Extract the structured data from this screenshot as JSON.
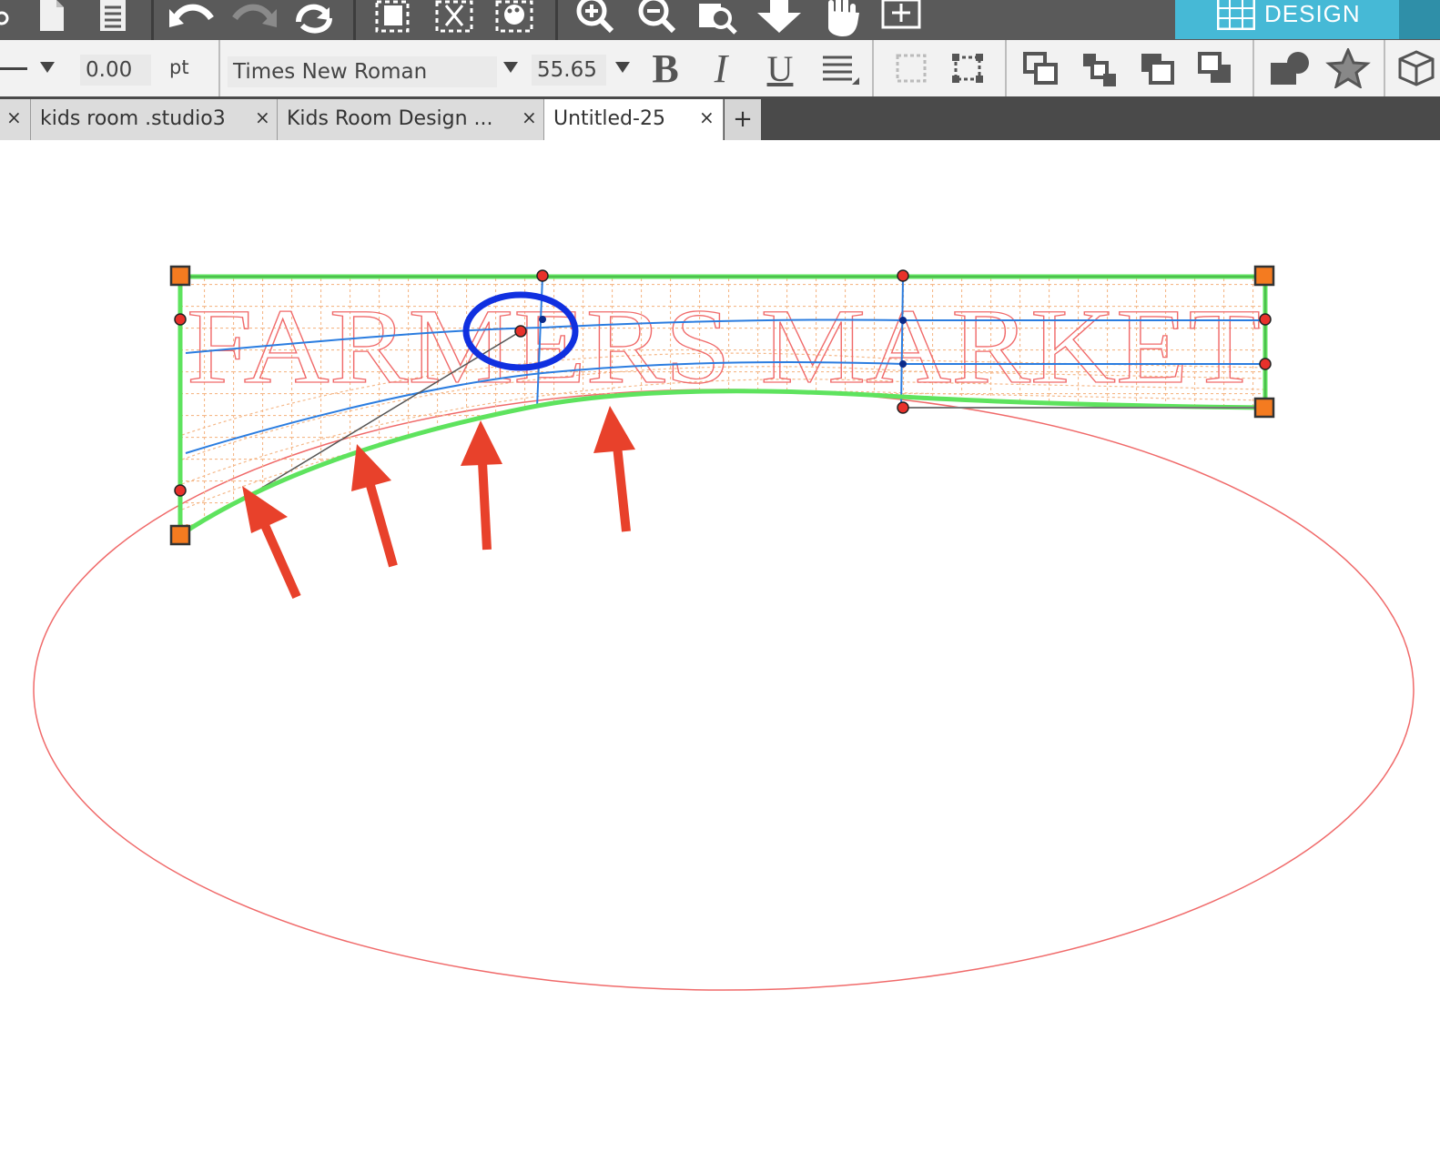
{
  "toolbar": {
    "design_label": "DESIGN"
  },
  "text_options": {
    "line_value": "0.00",
    "line_unit": "pt",
    "font_name": "Times New Roman",
    "font_size": "55.65",
    "bold_label": "B",
    "italic_label": "I",
    "underline_label": "U"
  },
  "tabs": [
    {
      "label": "kids room .studio3",
      "close": "×"
    },
    {
      "label": "Kids Room Design ...",
      "close": "×"
    },
    {
      "label": "Untitled-25",
      "close": "×"
    }
  ],
  "tab_add": "+",
  "first_tab_close": "×",
  "canvas": {
    "text": "FARMERS MARKET",
    "colors": {
      "text_outline": "#f06a6a",
      "selection_box": "#5ee35e",
      "handles": "#f47b20",
      "control_points": "#e8312b",
      "guide_lines": "#2b7de0",
      "annotation_arrows": "#e8412b",
      "annotation_circle": "#1030e0"
    }
  }
}
